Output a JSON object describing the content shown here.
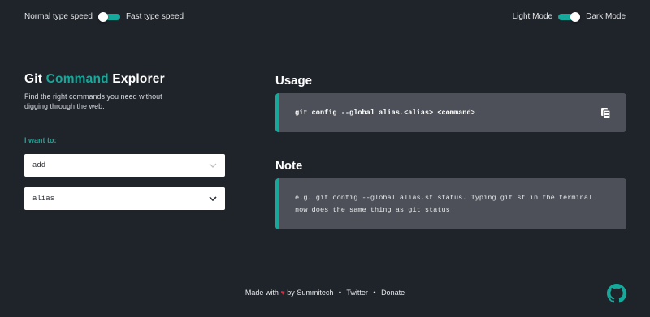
{
  "header": {
    "speed_toggle": {
      "left_label": "Normal type speed",
      "right_label": "Fast type speed",
      "state": "off"
    },
    "mode_toggle": {
      "left_label": "Light Mode",
      "right_label": "Dark Mode",
      "state": "on"
    }
  },
  "intro": {
    "title_part1": "Git",
    "title_accent": "Command",
    "title_part3": "Explorer",
    "subtitle": "Find the right commands you need without digging through the web."
  },
  "form": {
    "want_label": "I want to:",
    "first_select": {
      "value": "add",
      "icon": "chevron-down-icon"
    },
    "second_select": {
      "value": "alias",
      "icon": "chevron-down-icon"
    }
  },
  "usage": {
    "heading": "Usage",
    "command": "git config --global alias.<alias> <command>",
    "copy_icon": "copy-icon"
  },
  "note": {
    "heading": "Note",
    "text": "e.g. git config --global alias.st status. Typing git st in the terminal now does the same thing as git status"
  },
  "footer": {
    "made_with": "Made with",
    "heart": "♥",
    "by": "by",
    "author": "Summitech",
    "sep": "•",
    "twitter": "Twitter",
    "donate": "Donate",
    "github_icon": "github-icon"
  },
  "colors": {
    "background": "#1f232a",
    "accent": "#16a89a",
    "panel": "#4d5058",
    "heart": "#d6293e"
  }
}
